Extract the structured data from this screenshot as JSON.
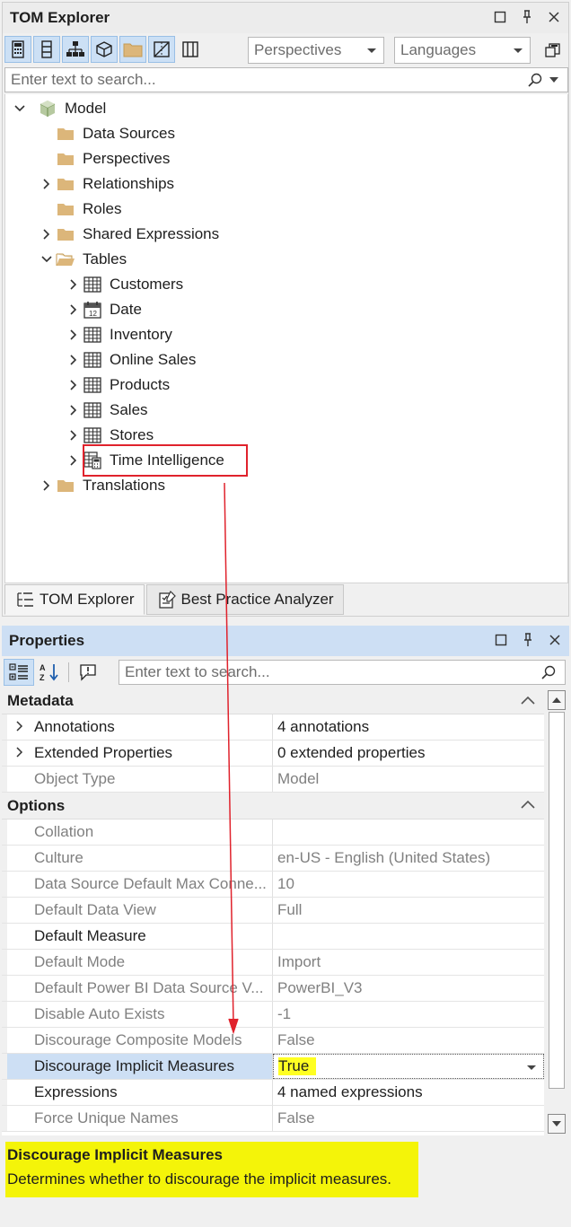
{
  "tom_explorer": {
    "title": "TOM Explorer",
    "perspectives_combo": "Perspectives",
    "languages_combo": "Languages",
    "search_placeholder": "Enter text to search...",
    "tree": {
      "model": "Model",
      "data_sources": "Data Sources",
      "perspectives": "Perspectives",
      "relationships": "Relationships",
      "roles": "Roles",
      "shared_expressions": "Shared Expressions",
      "tables": "Tables",
      "table_items": [
        "Customers",
        "Date",
        "Inventory",
        "Online Sales",
        "Products",
        "Sales",
        "Stores",
        "Time Intelligence"
      ],
      "translations": "Translations"
    },
    "tabs": [
      "TOM Explorer",
      "Best Practice Analyzer"
    ]
  },
  "properties": {
    "title": "Properties",
    "search_placeholder": "Enter text to search...",
    "categories": {
      "metadata": "Metadata",
      "options": "Options"
    },
    "metadata_rows": [
      {
        "name": "Annotations",
        "value": "4 annotations"
      },
      {
        "name": "Extended Properties",
        "value": "0 extended properties"
      },
      {
        "name": "Object Type",
        "value": "Model"
      }
    ],
    "options_rows": [
      {
        "name": "Collation",
        "value": ""
      },
      {
        "name": "Culture",
        "value": "en-US - English (United States)"
      },
      {
        "name": "Data Source Default Max Conne...",
        "value": "10"
      },
      {
        "name": "Default Data View",
        "value": "Full"
      },
      {
        "name": "Default Measure",
        "value": ""
      },
      {
        "name": "Default Mode",
        "value": "Import"
      },
      {
        "name": "Default Power BI Data Source V...",
        "value": "PowerBI_V3"
      },
      {
        "name": "Disable Auto Exists",
        "value": "-1"
      },
      {
        "name": "Discourage Composite Models",
        "value": "False"
      },
      {
        "name": "Discourage Implicit Measures",
        "value": "True"
      },
      {
        "name": "Expressions",
        "value": "4 named expressions"
      },
      {
        "name": "Force Unique Names",
        "value": "False"
      }
    ],
    "description": {
      "title": "Discourage Implicit Measures",
      "text": "Determines whether to discourage the implicit measures."
    }
  },
  "colors": {
    "highlight_box": "#e0222c",
    "selection": "#cddff4",
    "value_highlight": "#ffff22",
    "description_bg": "#f4f409",
    "folder": "#dcb67a"
  }
}
